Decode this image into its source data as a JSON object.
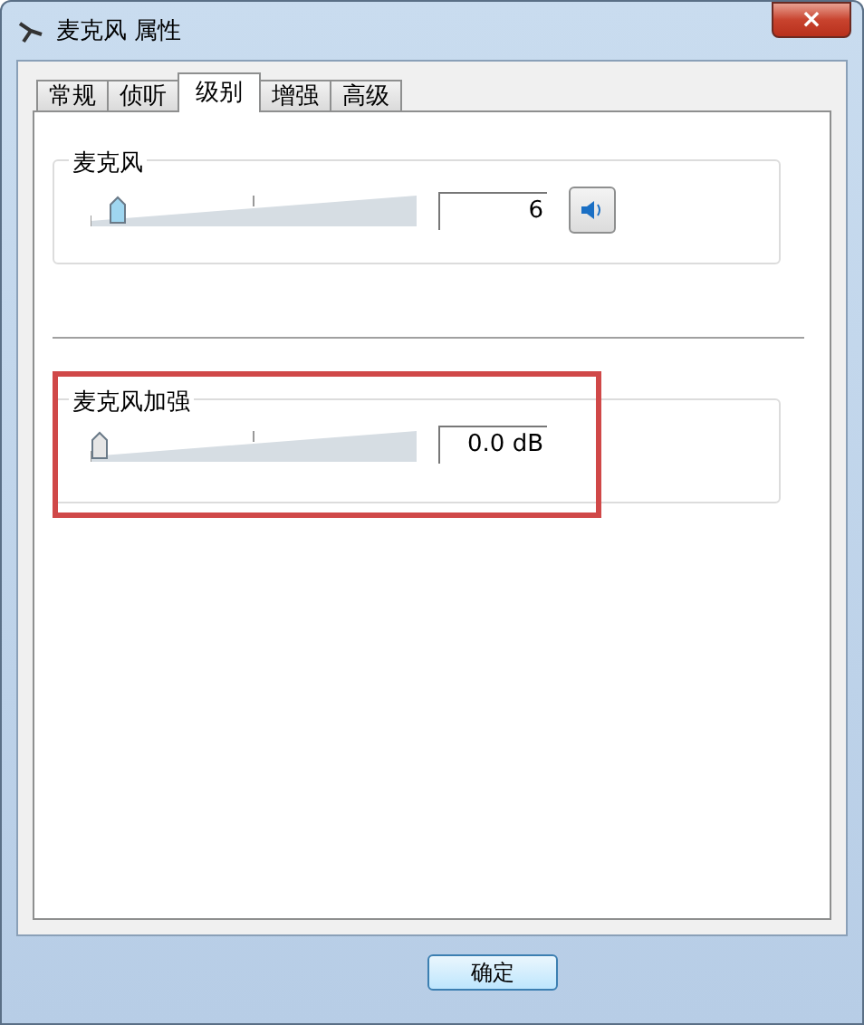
{
  "window": {
    "title": "麦克风 属性",
    "close": "×"
  },
  "tabs": [
    {
      "label": "常规",
      "selected": false
    },
    {
      "label": "侦听",
      "selected": false
    },
    {
      "label": "级别",
      "selected": true
    },
    {
      "label": "增强",
      "selected": false
    },
    {
      "label": "高级",
      "selected": false
    }
  ],
  "groups": [
    {
      "label": "麦克风",
      "level": 0.06,
      "value": "6",
      "mute_button": true,
      "highlighted": false
    },
    {
      "label": "麦克风加强",
      "level": 0,
      "value": "0.0 dB",
      "mute_button": false,
      "highlighted": true
    }
  ],
  "buttons": [
    "确定"
  ]
}
